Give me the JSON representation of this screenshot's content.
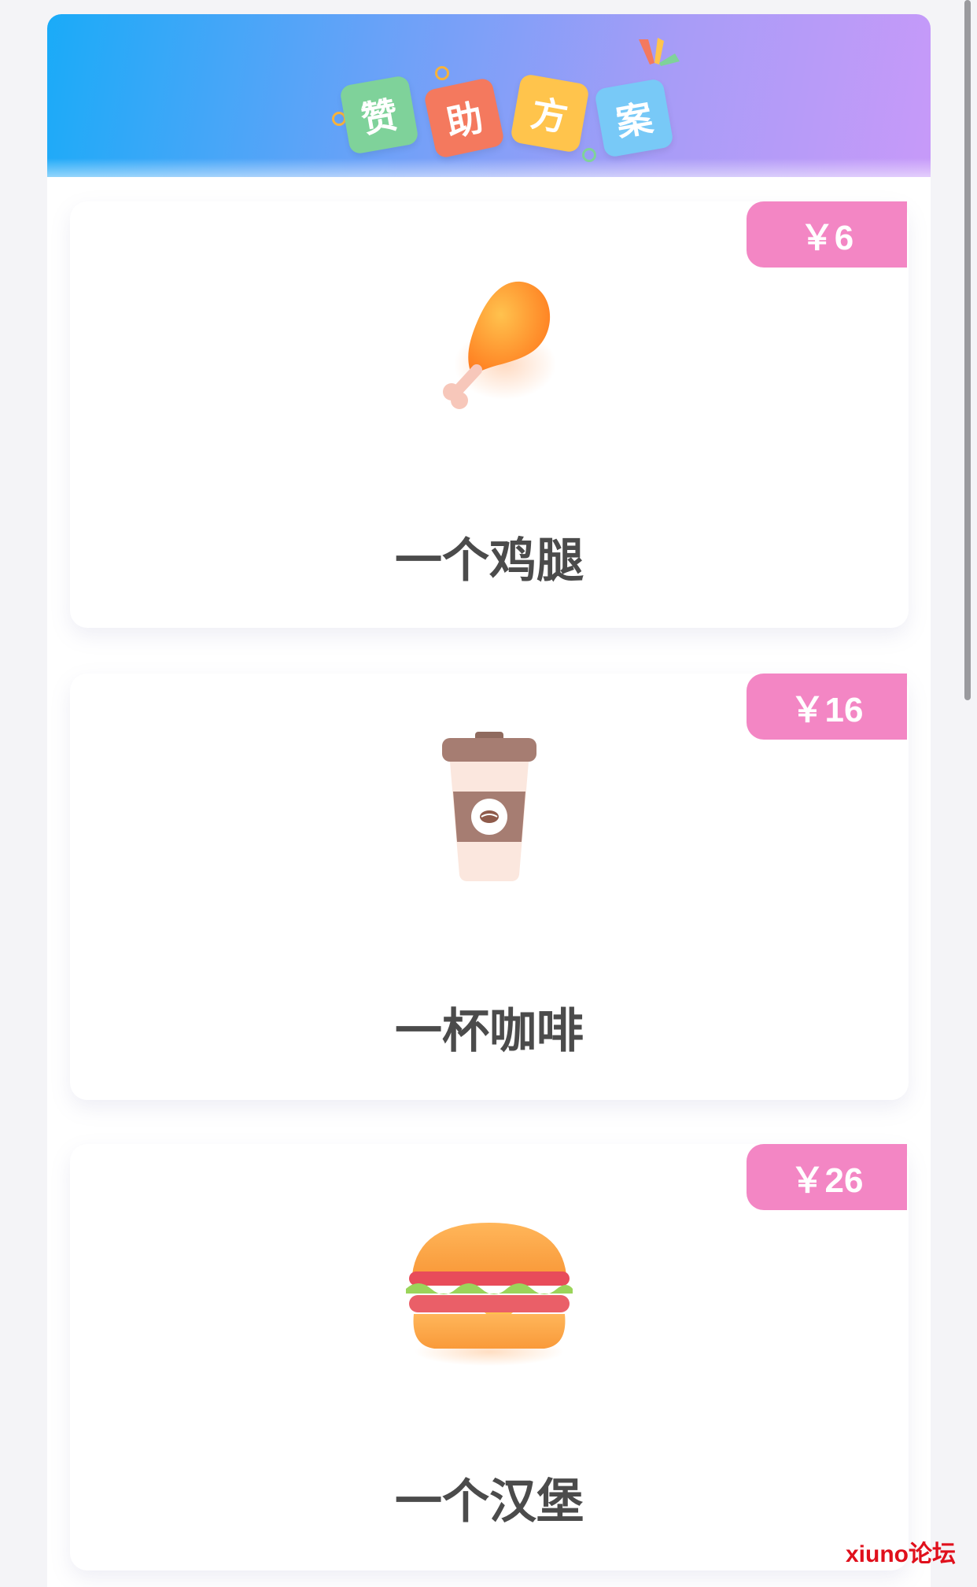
{
  "header": {
    "title_chars": [
      "赞",
      "助",
      "方",
      "案"
    ],
    "tile_colors": [
      "#7fd29a",
      "#f4795e",
      "#ffc44c",
      "#78c9f7"
    ]
  },
  "items": [
    {
      "price": "￥6",
      "label": "一个鸡腿",
      "icon": "chicken-drumstick-icon"
    },
    {
      "price": "￥16",
      "label": "一杯咖啡",
      "icon": "coffee-cup-icon"
    },
    {
      "price": "￥26",
      "label": "一个汉堡",
      "icon": "hamburger-icon"
    }
  ],
  "watermark": "xiuno论坛",
  "colors": {
    "price_badge": "#f386c4",
    "label_text": "#4b4b4b",
    "header_start": "#1aabf8",
    "header_end": "#c79af9"
  }
}
